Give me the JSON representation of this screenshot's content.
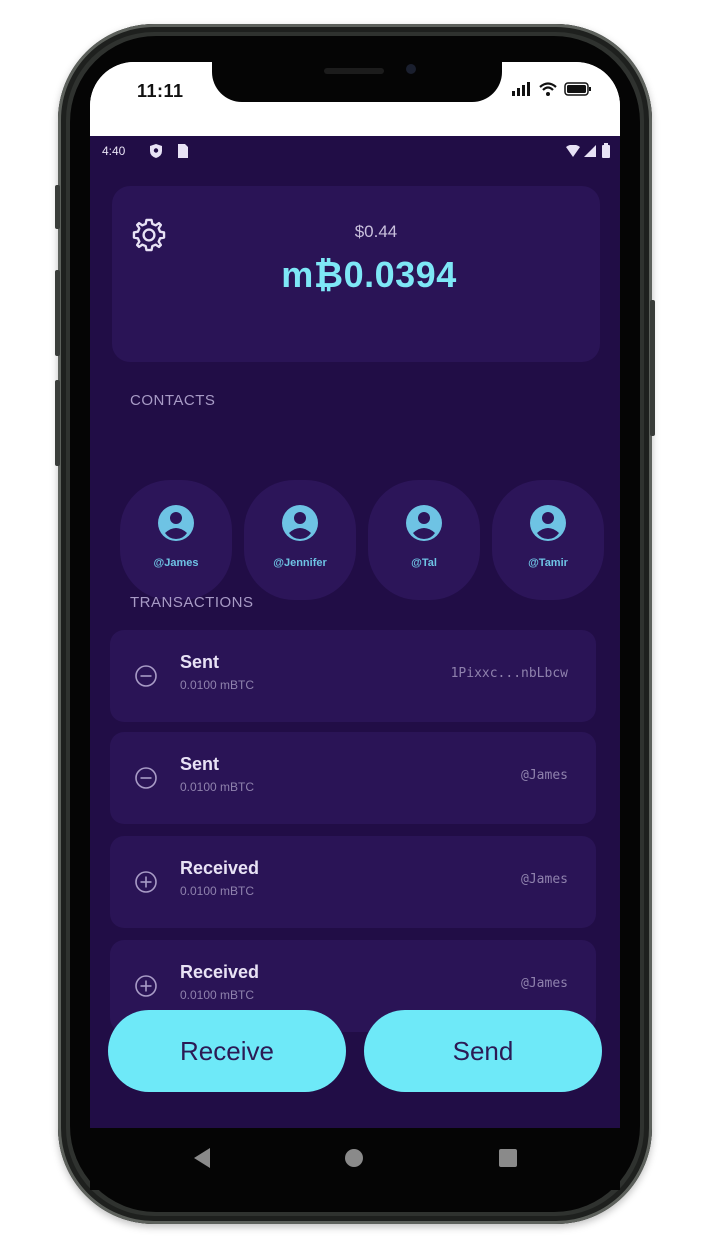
{
  "ios_status": {
    "time": "11:11"
  },
  "android_status": {
    "time": "4:40"
  },
  "balance": {
    "fiat": "$0.44",
    "crypto": "m₿0.0394"
  },
  "sections": {
    "contacts_label": "CONTACTS",
    "transactions_label": "TRANSACTIONS"
  },
  "contacts": [
    {
      "name": "@James"
    },
    {
      "name": "@Jennifer"
    },
    {
      "name": "@Tal"
    },
    {
      "name": "@Tamir"
    }
  ],
  "transactions": [
    {
      "type": "Sent",
      "amount": "0.0100 mBTC",
      "destination": "1Pixxc...nbLbcw",
      "icon": "minus-circle-icon"
    },
    {
      "type": "Sent",
      "amount": "0.0100 mBTC",
      "destination": "@James",
      "icon": "minus-circle-icon"
    },
    {
      "type": "Received",
      "amount": "0.0100 mBTC",
      "destination": "@James",
      "icon": "plus-circle-icon"
    },
    {
      "type": "Received",
      "amount": "0.0100 mBTC",
      "destination": "@James",
      "icon": "plus-circle-icon"
    }
  ],
  "actions": {
    "receive_label": "Receive",
    "send_label": "Send"
  },
  "colors": {
    "background": "#210d46",
    "card": "#2a1456",
    "accent": "#6ee9f8",
    "btc_text": "#7ee7f6"
  }
}
